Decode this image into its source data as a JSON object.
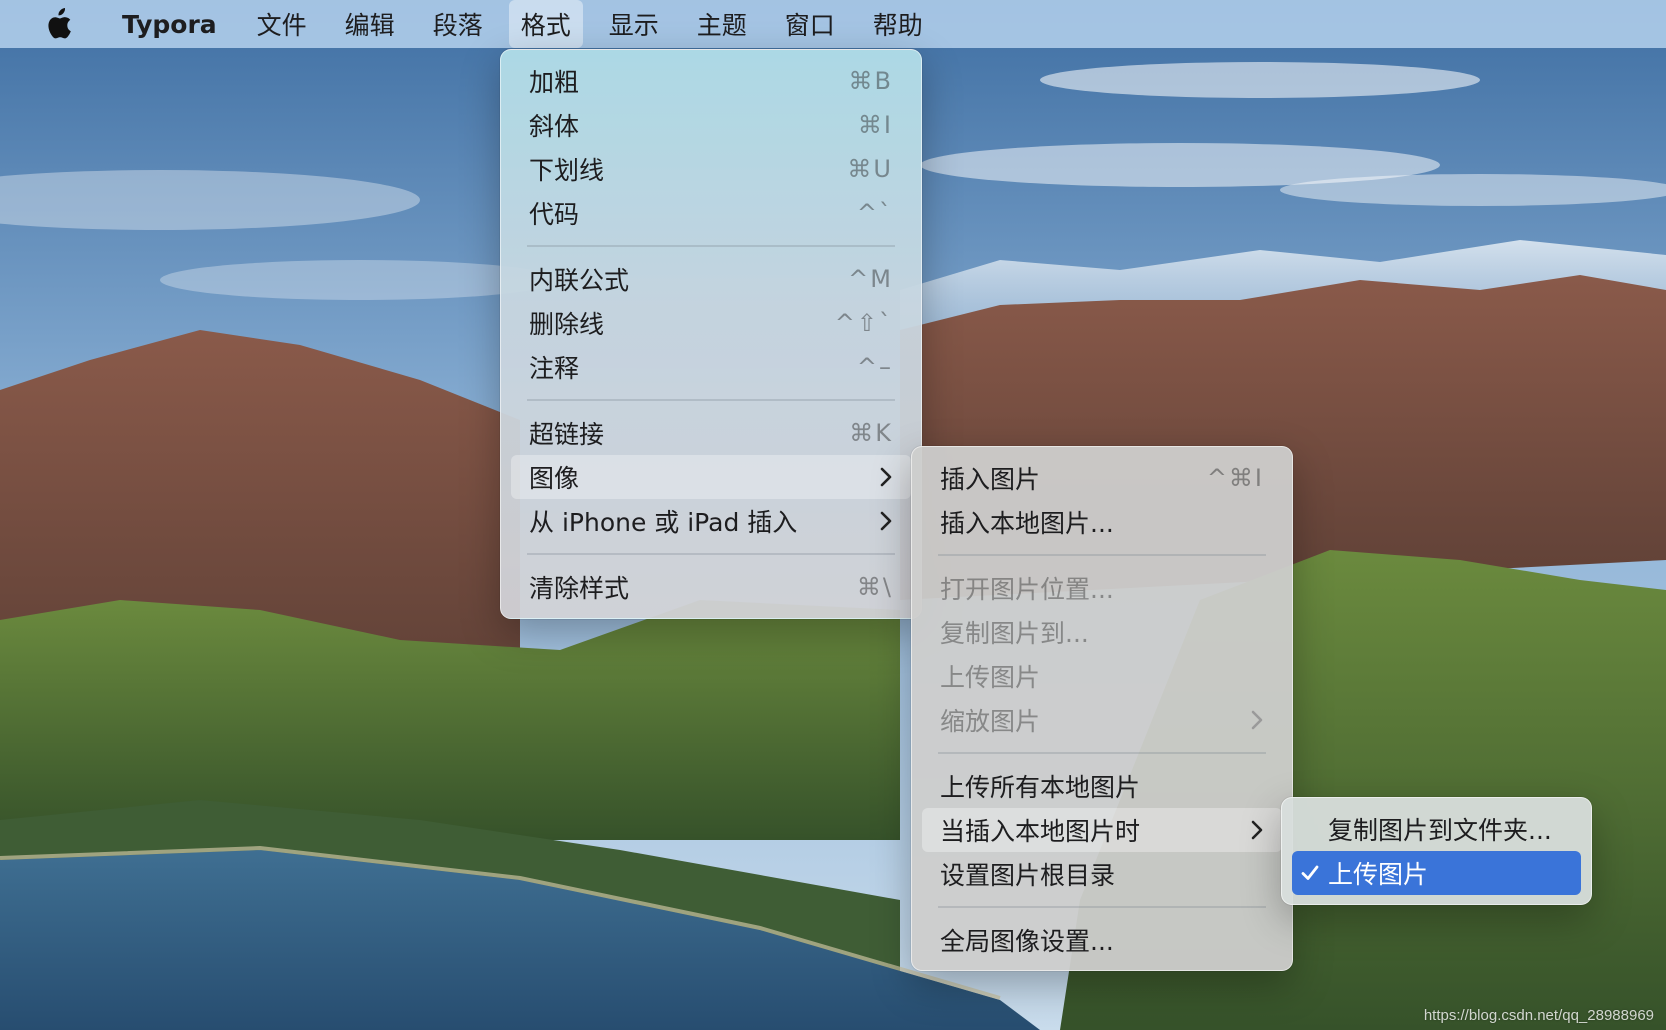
{
  "menubar": {
    "apple_icon": "apple-logo-icon",
    "items": [
      {
        "label": "Typora"
      },
      {
        "label": "文件"
      },
      {
        "label": "编辑"
      },
      {
        "label": "段落"
      },
      {
        "label": "格式"
      },
      {
        "label": "显示"
      },
      {
        "label": "主题"
      },
      {
        "label": "窗口"
      },
      {
        "label": "帮助"
      }
    ],
    "active_item": "格式"
  },
  "format_menu": {
    "items": [
      {
        "label": "加粗",
        "shortcut": "⌘B"
      },
      {
        "label": "斜体",
        "shortcut": "⌘I"
      },
      {
        "label": "下划线",
        "shortcut": "⌘U"
      },
      {
        "label": "代码",
        "shortcut": "^`"
      },
      {
        "label": "内联公式",
        "shortcut": "^M"
      },
      {
        "label": "删除线",
        "shortcut": "^⇧`"
      },
      {
        "label": "注释",
        "shortcut": "^–"
      },
      {
        "label": "超链接",
        "shortcut": "⌘K"
      },
      {
        "label": "图像"
      },
      {
        "label": "从 iPhone 或 iPad 插入"
      },
      {
        "label": "清除样式",
        "shortcut": "⌘\\"
      }
    ]
  },
  "image_menu": {
    "items": [
      {
        "label": "插入图片",
        "shortcut": "^⌘I"
      },
      {
        "label": "插入本地图片..."
      },
      {
        "label": "打开图片位置..."
      },
      {
        "label": "复制图片到..."
      },
      {
        "label": "上传图片"
      },
      {
        "label": "缩放图片"
      },
      {
        "label": "上传所有本地图片"
      },
      {
        "label": "当插入本地图片时"
      },
      {
        "label": "设置图片根目录"
      },
      {
        "label": "全局图像设置..."
      }
    ]
  },
  "when_insert_menu": {
    "items": [
      {
        "label": "复制图片到文件夹..."
      },
      {
        "label": "上传图片",
        "checked": true
      }
    ]
  },
  "colors": {
    "selection": "#3a74d9",
    "menubar": "#b9d6f0"
  },
  "watermark": "https://blog.csdn.net/qq_28988969"
}
